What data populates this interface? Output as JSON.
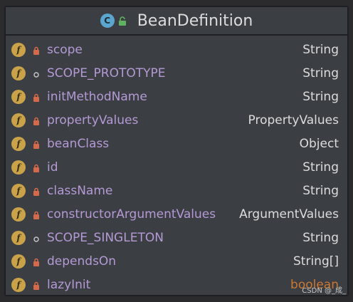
{
  "header": {
    "title": "BeanDefinition",
    "class_icon_letter": "C"
  },
  "fields": [
    {
      "name": "scope",
      "type": "String",
      "visibility": "private",
      "primitive": false
    },
    {
      "name": "SCOPE_PROTOTYPE",
      "type": "String",
      "visibility": "package",
      "primitive": false
    },
    {
      "name": "initMethodName",
      "type": "String",
      "visibility": "private",
      "primitive": false
    },
    {
      "name": "propertyValues",
      "type": "PropertyValues",
      "visibility": "private",
      "primitive": false
    },
    {
      "name": "beanClass",
      "type": "Object",
      "visibility": "private",
      "primitive": false
    },
    {
      "name": "id",
      "type": "String",
      "visibility": "private",
      "primitive": false
    },
    {
      "name": "className",
      "type": "String",
      "visibility": "private",
      "primitive": false
    },
    {
      "name": "constructorArgumentValues",
      "type": "ArgumentValues",
      "visibility": "private",
      "primitive": false
    },
    {
      "name": "SCOPE_SINGLETON",
      "type": "String",
      "visibility": "package",
      "primitive": false
    },
    {
      "name": "dependsOn",
      "type": "String[]",
      "visibility": "private",
      "primitive": false
    },
    {
      "name": "lazyInit",
      "type": "boolean",
      "visibility": "private",
      "primitive": true
    }
  ],
  "field_icon_letter": "f",
  "watermark": "CSDN @_成_",
  "colors": {
    "background": "#2b2b2d",
    "card": "#3b3e42",
    "field_name": "#b59ad6",
    "type_text": "#dcdcdc",
    "primitive_type": "#cc7832",
    "field_icon": "#c9a24a",
    "class_icon": "#5ba6ce",
    "lock": "#d46a4a"
  }
}
